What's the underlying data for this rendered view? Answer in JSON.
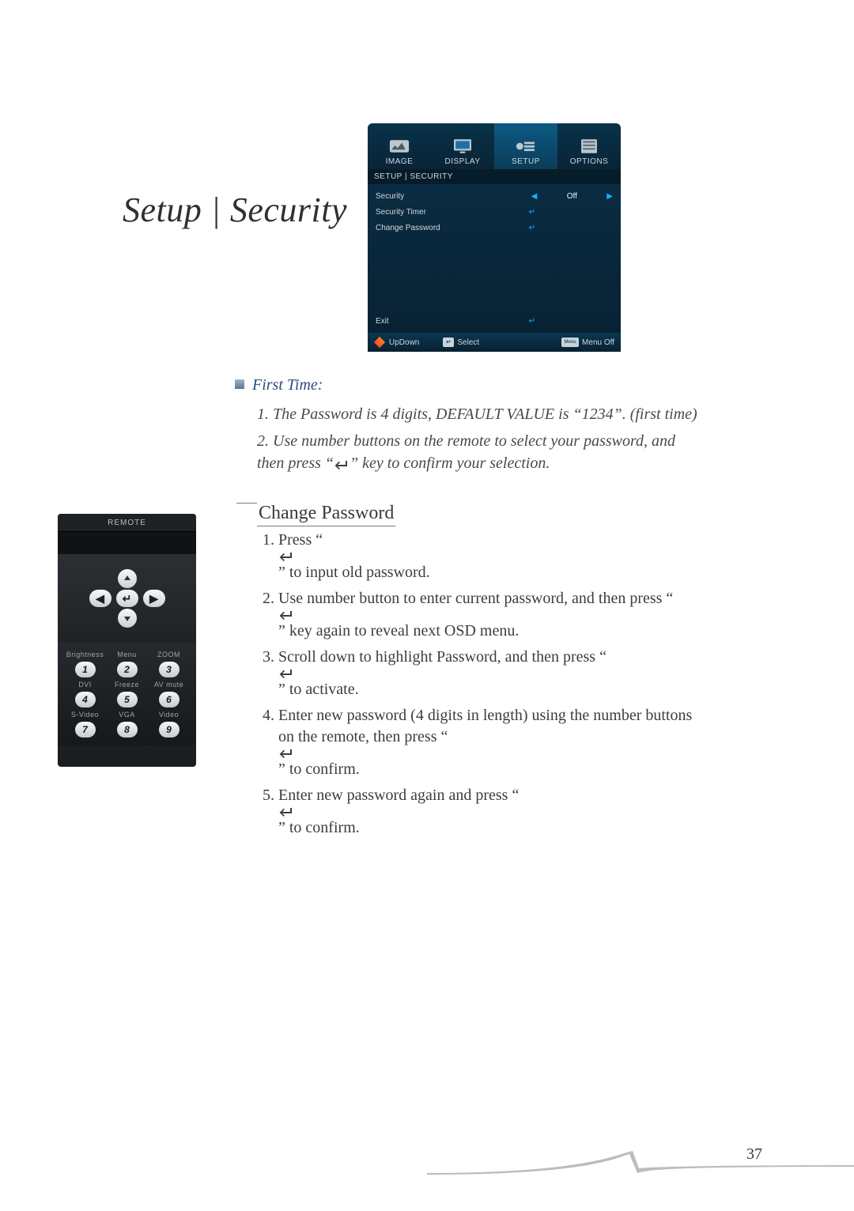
{
  "title": "Setup | Security",
  "osd": {
    "tabs": [
      "IMAGE",
      "DISPLAY",
      "SETUP",
      "OPTIONS"
    ],
    "breadcrumb": "SETUP | SECURITY",
    "rows": {
      "security": {
        "label": "Security",
        "value": "Off"
      },
      "timer": {
        "label": "Security Timer"
      },
      "change": {
        "label": "Change Password"
      },
      "exit": {
        "label": "Exit"
      }
    },
    "footer": {
      "updown": "UpDown",
      "select": "Select",
      "menuoff": "Menu Off",
      "menu_key": "Menu"
    }
  },
  "first_time": {
    "heading": "First Time:",
    "items": {
      "1": "1. The Password is 4 digits, DEFAULT VALUE is “1234”. (first time)",
      "2a": "2. Use number buttons on the remote to select your password, and then press “",
      "2b": "” key to confirm your selection."
    }
  },
  "change_password": {
    "heading": "Change Password",
    "items": {
      "1a": "Press “",
      "1b": "” to input old password.",
      "2a": "Use number button to enter current password, and then press “",
      "2b": "” key again to reveal next OSD menu.",
      "3a": "Scroll down to highlight Password, and then press “",
      "3b": "” to activate.",
      "4a": "Enter new password (4 digits in length) using the number buttons on the remote, then press “",
      "4b": "” to confirm.",
      "5a": "Enter new password again and press “",
      "5b": "” to confirm."
    }
  },
  "remote": {
    "title": "REMOTE",
    "labels": [
      "Brightness",
      "Menu",
      "ZOOM",
      "DVI",
      "Freeze",
      "AV mute",
      "S-Video",
      "VGA",
      "Video"
    ],
    "nums": [
      "1",
      "2",
      "3",
      "4",
      "5",
      "6",
      "7",
      "8",
      "9"
    ]
  },
  "page_number": "37"
}
